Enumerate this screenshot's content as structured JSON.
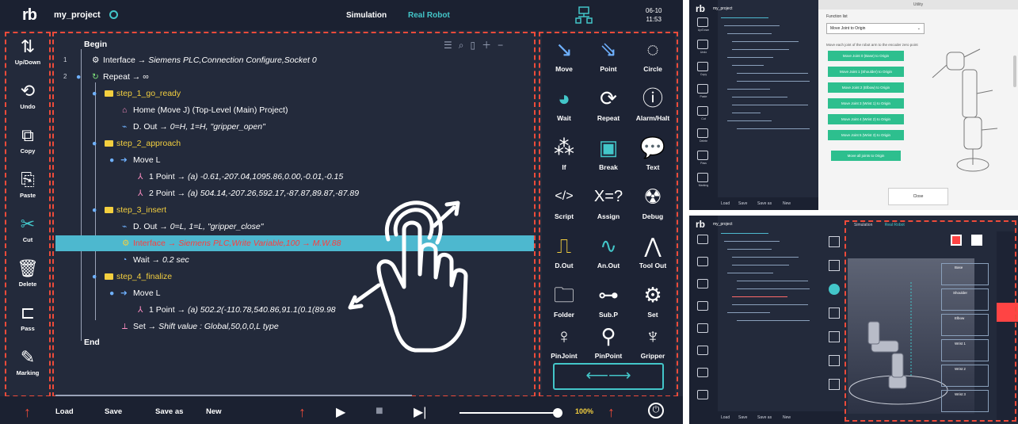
{
  "topbar": {
    "logo": "rb",
    "project": "my_project",
    "nav_simulation": "Simulation",
    "nav_real_robot": "Real Robot",
    "date": "06-10",
    "time": "11:53"
  },
  "left_tools": [
    {
      "label": "Up/Down",
      "icon": "up-down-arrows-icon"
    },
    {
      "label": "Undo",
      "icon": "undo-icon"
    },
    {
      "label": "Copy",
      "icon": "copy-icon"
    },
    {
      "label": "Paste",
      "icon": "paste-icon"
    },
    {
      "label": "Cut",
      "icon": "scissors-icon"
    },
    {
      "label": "Delete",
      "icon": "trash-icon"
    },
    {
      "label": "Pass",
      "icon": "pass-icon"
    },
    {
      "label": "Marking",
      "icon": "pen-icon"
    }
  ],
  "tree": {
    "begin": "Begin",
    "end": "End",
    "rows": [
      {
        "num": "1",
        "text": "Interface → ",
        "detail": "Siemens PLC,Connection Configure,Socket 0"
      },
      {
        "num": "2",
        "text": "Repeat → ∞",
        "detail": ""
      },
      {
        "num": "",
        "text": "step_1_go_ready",
        "detail": ""
      },
      {
        "num": "",
        "text": "Home (Move J) (Top-Level (Main) Project)",
        "detail": ""
      },
      {
        "num": "",
        "text": "D. Out → ",
        "detail": "0=H, 1=H, \"gripper_open\""
      },
      {
        "num": "",
        "text": "step_2_approach",
        "detail": ""
      },
      {
        "num": "",
        "text": "Move L",
        "detail": ""
      },
      {
        "num": "",
        "text": "1 Point → ",
        "detail": "(a) -0.61,-207.04,1095.86,0.00,-0.01,-0.15"
      },
      {
        "num": "",
        "text": "2 Point → ",
        "detail": "(a) 504.14,-207.26,592.17,-87.87,89.87,-87.89"
      },
      {
        "num": "",
        "text": "step_3_insert",
        "detail": ""
      },
      {
        "num": "",
        "text": "D. Out → ",
        "detail": "0=L, 1=L, \"gripper_close\""
      },
      {
        "num": "",
        "text": "Interface → ",
        "detail": "Siemens PLC,Write Variable,100 → M.W.88"
      },
      {
        "num": "",
        "text": "Wait → ",
        "detail": "0.2 sec"
      },
      {
        "num": "",
        "text": "step_4_finalize",
        "detail": ""
      },
      {
        "num": "",
        "text": "Move L",
        "detail": ""
      },
      {
        "num": "",
        "text": "1 Point → ",
        "detail": "(a) 502.2(-110.78,540.86,91.1(0.1(89.98"
      },
      {
        "num": "",
        "text": "Set → ",
        "detail": "Shift value : Global,50,0,0,L type"
      }
    ]
  },
  "palette": [
    {
      "label": "Move",
      "icon": "move-arrow-icon"
    },
    {
      "label": "Point",
      "icon": "point-arrow-icon"
    },
    {
      "label": "Circle",
      "icon": "circle-icon"
    },
    {
      "label": "Wait",
      "icon": "clock-icon"
    },
    {
      "label": "Repeat",
      "icon": "repeat-icon"
    },
    {
      "label": "Alarm/Halt",
      "icon": "alarm-icon"
    },
    {
      "label": "If",
      "icon": "if-icon"
    },
    {
      "label": "Break",
      "icon": "break-icon"
    },
    {
      "label": "Text",
      "icon": "speech-bubble-icon"
    },
    {
      "label": "Script",
      "icon": "script-icon"
    },
    {
      "label": "Assign",
      "icon": "assign-icon"
    },
    {
      "label": "Debug",
      "icon": "bug-icon"
    },
    {
      "label": "D.Out",
      "icon": "digital-out-icon"
    },
    {
      "label": "An.Out",
      "icon": "analog-out-icon"
    },
    {
      "label": "Tool Out",
      "icon": "gripper-tool-icon"
    },
    {
      "label": "Folder",
      "icon": "folder-icon"
    },
    {
      "label": "Sub.P",
      "icon": "subprogram-icon"
    },
    {
      "label": "Set",
      "icon": "gear-icon"
    },
    {
      "label": "PinJoint",
      "icon": "pin-joint-icon"
    },
    {
      "label": "PinPoint",
      "icon": "pin-point-icon"
    },
    {
      "label": "Gripper",
      "icon": "gripper-icon"
    }
  ],
  "bottombar": {
    "load": "Load",
    "save": "Save",
    "save_as": "Save as",
    "new": "New",
    "zoom": "100%",
    "speed_fraction": 0.95
  },
  "thumb1": {
    "logo": "rb",
    "project": "my_project",
    "dialog_title": "Utility",
    "function_label": "Function list",
    "function_value": "Move Joint to Origin",
    "description": "Move each joint of the robot arm to the encoder zero point",
    "buttons": [
      "Move Joint 0 (Base) to Origin",
      "Move Joint 1 (Shoulder) to Origin",
      "Move Joint 2 (Elbow) to Origin",
      "Move Joint 3 (Wrist 1) to Origin",
      "Move Joint 4 (Wrist 2) to Origin",
      "Move Joint 5 (Wrist 3) to Origin",
      "Move all joints to Origin"
    ],
    "close": "Close",
    "bottom": [
      "Load",
      "Save",
      "Save as",
      "New"
    ],
    "side_labels": [
      "Up/Down",
      "Undo",
      "Copy",
      "Paste",
      "Cut",
      "Delete",
      "Pass",
      "Marking"
    ]
  },
  "thumb2": {
    "logo": "rb",
    "project": "my_project",
    "tab_simulation": "Simulation",
    "tab_real_robot": "Real Robot",
    "joints": [
      "Base",
      "Shoulder",
      "Elbow",
      "Wrist 1",
      "Wrist 2",
      "Wrist 3"
    ],
    "bottom": [
      "Load",
      "Save",
      "Save as",
      "New"
    ]
  },
  "colors": {
    "background": "#232a3b",
    "accent": "#43c6c9",
    "highlight": "#f3cf3f",
    "dashed": "#ee4b3a",
    "selected_row": "#4db8cf"
  }
}
